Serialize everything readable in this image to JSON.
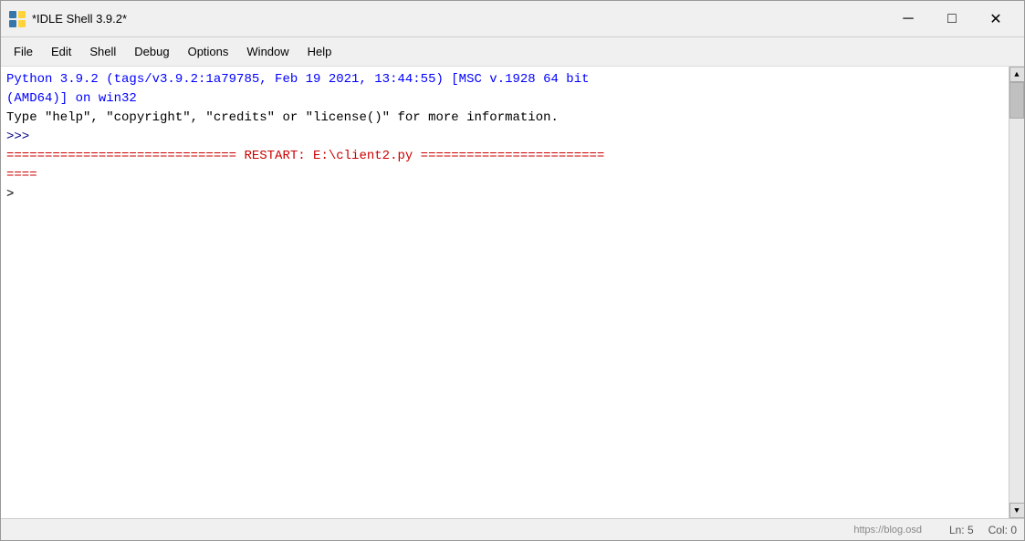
{
  "window": {
    "title": "*IDLE Shell 3.9.2*"
  },
  "titlebar": {
    "minimize_label": "─",
    "maximize_label": "□",
    "close_label": "✕"
  },
  "menubar": {
    "items": [
      "File",
      "Edit",
      "Shell",
      "Debug",
      "Options",
      "Window",
      "Help"
    ]
  },
  "shell": {
    "line1": "Python 3.9.2 (tags/v3.9.2:1a79785, Feb 19 2021, 13:44:55) [MSC v.1928 64 bit",
    "line2": "(AMD64)] on win32",
    "line3": "Type \"help\", \"copyright\", \"credits\" or \"license()\" for more information.",
    "line4": ">>> ",
    "line5": "============================== RESTART: E:\\client2.py ========================",
    "line6": "====",
    "line7": "> "
  },
  "statusbar": {
    "url": "https://blog.osd",
    "ln": "Ln: 5",
    "col": "Col: 0"
  }
}
